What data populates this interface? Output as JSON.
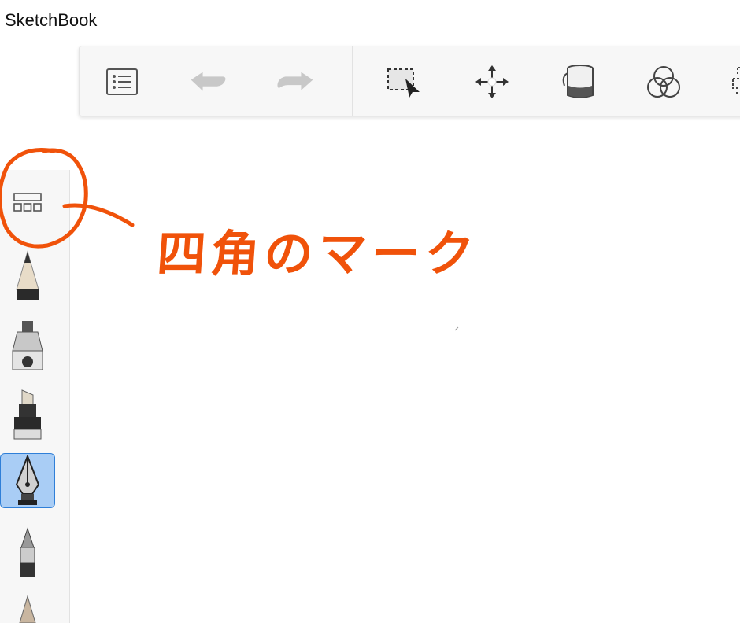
{
  "window": {
    "title": "SketchBook"
  },
  "toolbar": {
    "buttons": [
      {
        "id": "menu",
        "icon": "list-menu-icon"
      },
      {
        "id": "undo",
        "icon": "undo-arrow-icon"
      },
      {
        "id": "redo",
        "icon": "redo-arrow-icon"
      },
      {
        "id": "select",
        "icon": "selection-icon"
      },
      {
        "id": "transform",
        "icon": "move-arrows-icon"
      },
      {
        "id": "fill",
        "icon": "paint-bucket-icon"
      },
      {
        "id": "color-editor",
        "icon": "color-circles-icon"
      },
      {
        "id": "more",
        "icon": "partial-tool-icon"
      }
    ]
  },
  "side_panel": {
    "items": [
      {
        "id": "brush-library",
        "icon": "brush-library-grid-icon"
      },
      {
        "id": "pencil",
        "icon": "pencil-icon"
      },
      {
        "id": "airbrush",
        "icon": "airbrush-icon"
      },
      {
        "id": "marker",
        "icon": "marker-icon"
      },
      {
        "id": "ink-pen",
        "icon": "ink-pen-nib-icon",
        "selected": true
      },
      {
        "id": "ballpoint",
        "icon": "ballpoint-pen-icon"
      },
      {
        "id": "brush-partial",
        "icon": "brush-tip-icon"
      }
    ]
  },
  "annotation": {
    "text": "四角のマーク",
    "color": "#f0520a"
  },
  "colors": {
    "accent": "#2f7fd8",
    "selected_bg": "#a9cdf5",
    "annotation": "#f0520a"
  }
}
